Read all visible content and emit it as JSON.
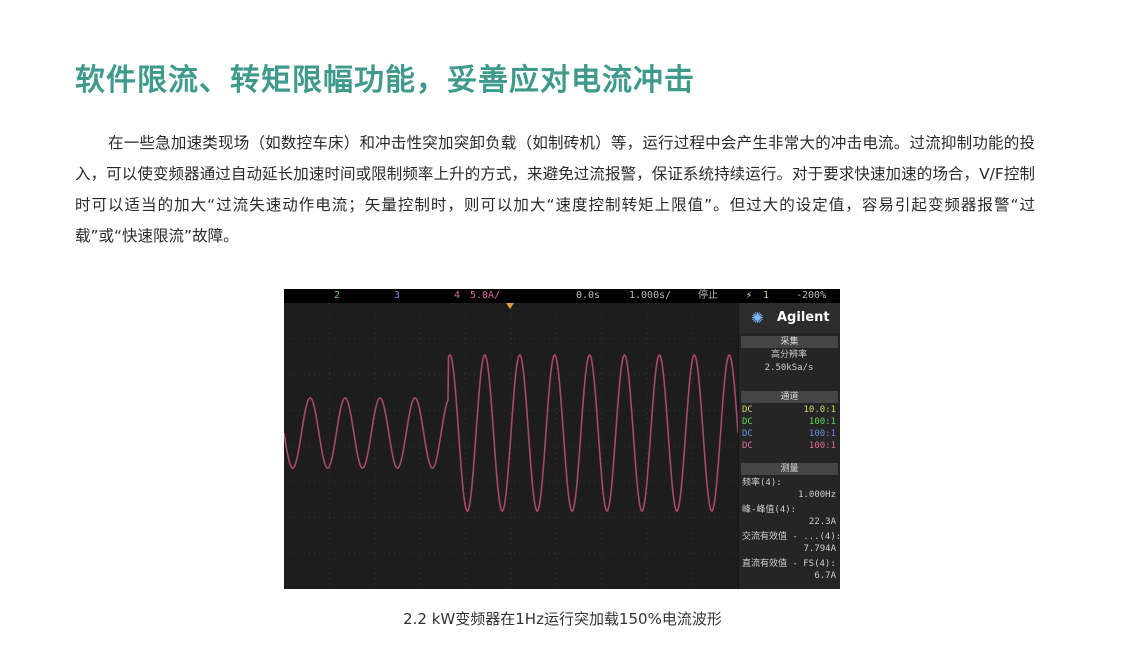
{
  "title": "软件限流、转矩限幅功能，妥善应对电流冲击",
  "paragraph": "在一些急加速类现场（如数控车床）和冲击性突加突卸负载（如制砖机）等，运行过程中会产生非常大的冲击电流。过流抑制功能的投入，可以使变频器通过自动延长加速时间或限制频率上升的方式，来避免过流报警，保证系统持续运行。对于要求快速加速的场合，V/F控制时可以适当的加大“过流失速动作电流；矢量控制时，则可以加大“速度控制转矩上限值”。但过大的设定值，容易引起变频器报警“过载”或“快速限流”故障。",
  "scope": {
    "topbar": {
      "ch2": "2",
      "ch3": "3",
      "ch4": "4",
      "ch4_scale": "5.0A/",
      "time_pos": "0.0s",
      "time_scale": "1.000s/",
      "run_state": "停止",
      "trig_ch": "1",
      "trig_level": "-200%"
    },
    "brand": "Agilent",
    "acquire": {
      "header": "采集",
      "mode": "高分辨率",
      "rate": "2.50kSa/s"
    },
    "channels": {
      "header": "通道",
      "rows": [
        {
          "coupling": "DC",
          "value": "10.0:1",
          "color": "#d8d36a"
        },
        {
          "coupling": "DC",
          "value": "100:1",
          "color": "#5fd35f"
        },
        {
          "coupling": "DC",
          "value": "100:1",
          "color": "#6a8ee0"
        },
        {
          "coupling": "DC",
          "value": "100:1",
          "color": "#e06aa0"
        }
      ]
    },
    "measure": {
      "header": "测量",
      "items": [
        {
          "label": "频率(4):",
          "value": "1.000Hz"
        },
        {
          "label": "峰-峰值(4):",
          "value": "22.3A"
        },
        {
          "label": "交流有效值 - ...(4):",
          "value": "7.794A"
        },
        {
          "label": "直流有效值 - FS(4):",
          "value": "6.7A"
        }
      ]
    },
    "waveform": {
      "trace_color": "#a8486a",
      "cycles": 13,
      "step_at_cycle": 5,
      "amplitude_before": 0.45,
      "amplitude_after": 1.0
    }
  },
  "caption": "2.2 kW变频器在1Hz运行突加载150%电流波形",
  "colors": {
    "title": "#3f9a8c",
    "accent_marker": "#e0a040"
  }
}
